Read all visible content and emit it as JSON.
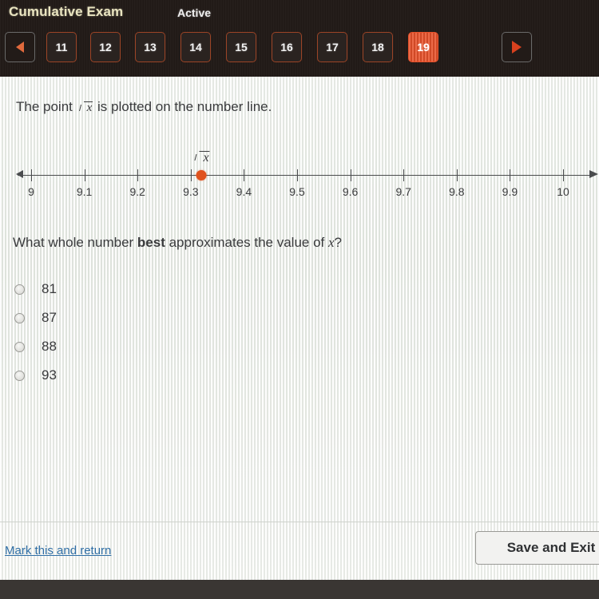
{
  "header": {
    "exam_title": "Cumulative Exam",
    "status_label": "Active",
    "prev_icon": "triangle-left-icon",
    "next_icon": "triangle-right-icon",
    "pages": [
      {
        "label": "11",
        "active": false
      },
      {
        "label": "12",
        "active": false
      },
      {
        "label": "13",
        "active": false
      },
      {
        "label": "14",
        "active": false
      },
      {
        "label": "15",
        "active": false
      },
      {
        "label": "16",
        "active": false
      },
      {
        "label": "17",
        "active": false
      },
      {
        "label": "18",
        "active": false
      },
      {
        "label": "19",
        "active": true
      }
    ]
  },
  "question": {
    "prompt_before": "The point",
    "prompt_radical": "x",
    "prompt_after": "is plotted on the number line.",
    "stem_before": "What whole number ",
    "stem_bold": "best",
    "stem_mid": " approximates the value of ",
    "stem_var": "x",
    "stem_after": "?",
    "choices": [
      {
        "label": "81",
        "selected": false
      },
      {
        "label": "87",
        "selected": false
      },
      {
        "label": "88",
        "selected": false
      },
      {
        "label": "93",
        "selected": false
      }
    ]
  },
  "chart_data": {
    "type": "number-line",
    "title": "",
    "xlabel": "",
    "ylabel": "",
    "axis_min": 9,
    "axis_max": 10,
    "tick_step": 0.1,
    "tick_labels": [
      "9",
      "9.1",
      "9.2",
      "9.3",
      "9.4",
      "9.5",
      "9.6",
      "9.7",
      "9.8",
      "9.9",
      "10"
    ],
    "tick_values": [
      9,
      9.1,
      9.2,
      9.3,
      9.4,
      9.5,
      9.6,
      9.7,
      9.8,
      9.9,
      10
    ],
    "points": [
      {
        "label": "√x",
        "value": 9.32,
        "color": "#e0521e"
      }
    ],
    "arrows": [
      "left",
      "right"
    ],
    "grid": false,
    "legend": "none"
  },
  "colors": {
    "accent": "#e8512a",
    "button_border": "#9c4426",
    "link": "#2f6ea5",
    "header_bg": "#211a17",
    "title_text": "#e9e4c0",
    "point": "#e0521e"
  },
  "footer": {
    "mark_link": "Mark this and return",
    "save_exit": "Save and Exit"
  }
}
